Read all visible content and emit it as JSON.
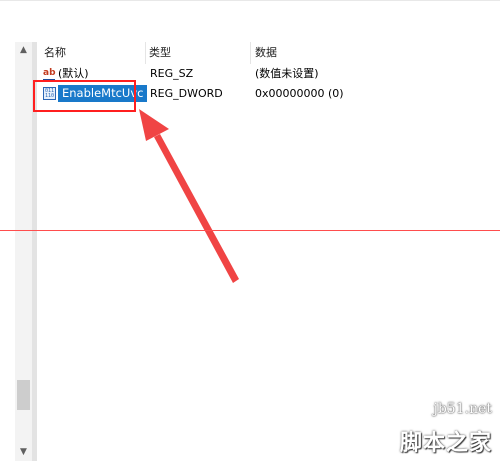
{
  "columns": {
    "name": "名称",
    "type": "类型",
    "data": "数据"
  },
  "rows": [
    {
      "icon": "string-value-icon",
      "icon_text": "ab",
      "name": "(默认)",
      "type": "REG_SZ",
      "data": "(数值未设置)"
    },
    {
      "icon": "dword-value-icon",
      "icon_text": "011 110",
      "name": "EnableMtcUvc",
      "type": "REG_DWORD",
      "data": "0x00000000 (0)",
      "selected": true
    }
  ],
  "scroll": {
    "up": "▲",
    "down": "▼"
  },
  "annotation": {
    "box_color": "#ff1f1f",
    "arrow_color": "#f04444"
  },
  "colors": {
    "selection": "#1979ca"
  },
  "watermark": {
    "url": "jb51.net",
    "text": "脚本之家"
  }
}
